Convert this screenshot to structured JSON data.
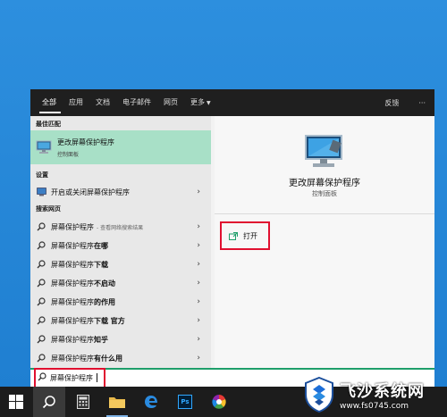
{
  "search_panel": {
    "tabs": [
      {
        "label": "全部"
      },
      {
        "label": "应用"
      },
      {
        "label": "文档"
      },
      {
        "label": "电子邮件"
      },
      {
        "label": "网页"
      },
      {
        "label": "更多"
      }
    ],
    "feedback_label": "反馈",
    "more_options_label": "···",
    "best_match_header": "最佳匹配",
    "best_match": {
      "title": "更改屏幕保护程序",
      "subtitle": "控制面板"
    },
    "settings_header": "设置",
    "settings_item": "开启或关闭屏幕保护程序",
    "web_header": "搜索网页",
    "web_items": [
      {
        "prefix": "屏幕保护程序",
        "suffix": "",
        "hint": "- 查看网络搜索结果"
      },
      {
        "prefix": "屏幕保护程序",
        "suffix": "在哪",
        "hint": ""
      },
      {
        "prefix": "屏幕保护程序",
        "suffix": "下载",
        "hint": ""
      },
      {
        "prefix": "屏幕保护程序",
        "suffix": "不启动",
        "hint": ""
      },
      {
        "prefix": "屏幕保护程序",
        "suffix": "的作用",
        "hint": ""
      },
      {
        "prefix": "屏幕保护程序",
        "suffix": "下载 官方",
        "hint": ""
      },
      {
        "prefix": "屏幕保护程序",
        "suffix": " 知乎",
        "hint": ""
      },
      {
        "prefix": "屏幕保护程序",
        "suffix": "有什么用",
        "hint": ""
      }
    ],
    "detail": {
      "title": "更改屏幕保护程序",
      "subtitle": "控制面板",
      "open_label": "打开"
    },
    "search_value": "屏幕保护程序"
  },
  "taskbar": {
    "ps_label": "Ps"
  },
  "watermark": {
    "title": "飞沙系统网",
    "url": "www.fs0745.com"
  },
  "colors": {
    "accent": "#1e9e6a",
    "highlight_red": "#e01030",
    "best_match_bg": "#a8e0c7"
  }
}
